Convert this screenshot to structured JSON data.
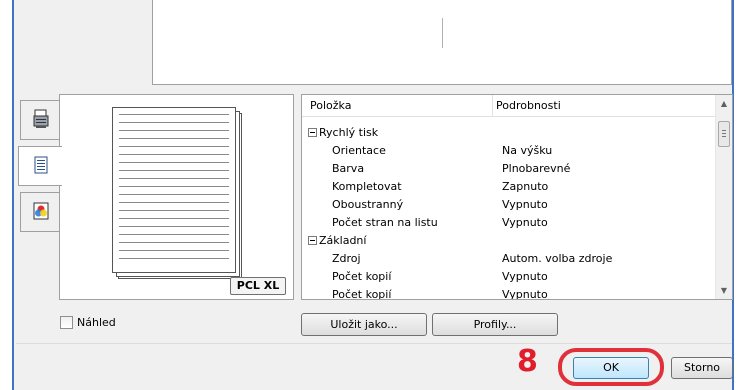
{
  "preview_tabs": [
    {
      "icon": "printer-icon"
    },
    {
      "icon": "document-icon"
    },
    {
      "icon": "color-icon"
    }
  ],
  "preview": {
    "badge": "PCL XL"
  },
  "settings_list": {
    "columns": [
      "Položka",
      "Podrobnosti"
    ],
    "rows": [
      {
        "item": "Rychlý tisk",
        "value": "",
        "group": true
      },
      {
        "item": "Orientace",
        "value": "Na výšku"
      },
      {
        "item": "Barva",
        "value": "Plnobarevné"
      },
      {
        "item": "Kompletovat",
        "value": "Zapnuto"
      },
      {
        "item": "Oboustranný",
        "value": "Vypnuto"
      },
      {
        "item": "Počet stran na listu",
        "value": "Vypnuto"
      },
      {
        "item": "Základní",
        "value": "",
        "group": true
      },
      {
        "item": "Zdroj",
        "value": "Autom. volba zdroje"
      },
      {
        "item": "Počet kopií",
        "value": "Vypnuto"
      },
      {
        "item": "Počet kopií",
        "value": "Vypnuto"
      }
    ]
  },
  "checkbox": {
    "label": "Náhled",
    "checked": false
  },
  "buttons": {
    "save_as": "Uložit jako...",
    "profiles": "Profily...",
    "ok": "OK",
    "cancel": "Storno"
  },
  "step_marker": "8",
  "colors": {
    "highlight": "#e01e2b",
    "window_border": "#3e73c6"
  }
}
